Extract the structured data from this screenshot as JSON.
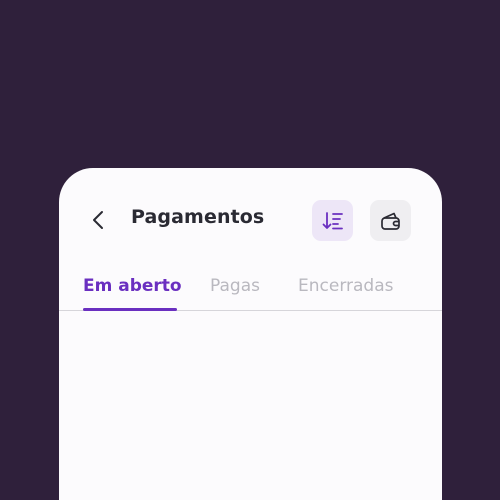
{
  "header": {
    "title": "Pagamentos",
    "back_icon": "chevron-left-icon",
    "sort_icon": "sort-descending-icon",
    "wallet_icon": "wallet-icon"
  },
  "tabs": [
    {
      "label": "Em aberto",
      "active": true
    },
    {
      "label": "Pagas",
      "active": false
    },
    {
      "label": "Encerradas",
      "active": false
    }
  ],
  "colors": {
    "background": "#2f203b",
    "accent": "#6a2fc0",
    "accent_soft": "#ede6f7",
    "surface": "#fcfbfd",
    "inactive_tab": "#b9b8bf"
  }
}
